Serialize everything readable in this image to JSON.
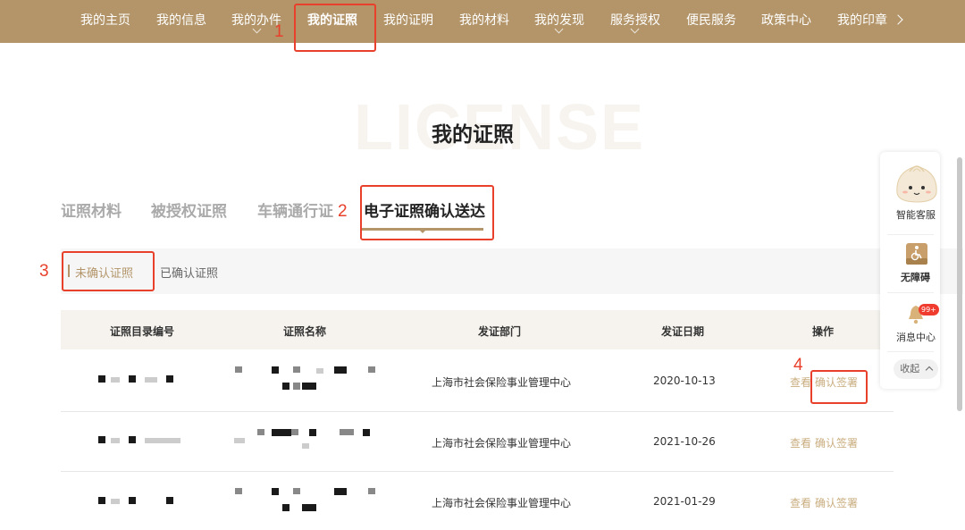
{
  "nav": {
    "items": [
      {
        "label": "我的主页"
      },
      {
        "label": "我的信息"
      },
      {
        "label": "我的办件"
      },
      {
        "label": "我的证照"
      },
      {
        "label": "我的证明"
      },
      {
        "label": "我的材料"
      },
      {
        "label": "我的发现"
      },
      {
        "label": "服务授权"
      },
      {
        "label": "便民服务"
      },
      {
        "label": "政策中心"
      },
      {
        "label": "我的印章"
      }
    ],
    "active_label": "我的证照"
  },
  "annotations": [
    "1",
    "2",
    "3",
    "4"
  ],
  "page": {
    "bg_word": "LICENSE",
    "title": "我的证照"
  },
  "tabs": [
    {
      "label": "证照材料"
    },
    {
      "label": "被授权证照"
    },
    {
      "label": "车辆通行证"
    },
    {
      "label": "电子证照确认送达"
    }
  ],
  "active_tab": "电子证照确认送达",
  "subtabs": [
    {
      "label": "未确认证照"
    },
    {
      "label": "已确认证照"
    }
  ],
  "table": {
    "headers": [
      "证照目录编号",
      "证照名称",
      "发证部门",
      "发证日期",
      "操作"
    ],
    "rows": [
      {
        "department": "上海市社会保险事业管理中心",
        "date": "2020-10-13",
        "view": "查看",
        "confirm": "确认签署"
      },
      {
        "department": "上海市社会保险事业管理中心",
        "date": "2021-10-26",
        "view": "查看",
        "confirm": "确认签署"
      },
      {
        "department": "上海市社会保险事业管理中心",
        "date": "2021-01-29",
        "view": "查看",
        "confirm": "确认签署"
      }
    ]
  },
  "side_panel": {
    "service": "智能客服",
    "accessibility": "无障碍",
    "messages": "消息中心",
    "badge": "99+",
    "collapse": "收起"
  },
  "colors": {
    "brand": "#b39569",
    "annotation": "#e8402b",
    "link": "#c9ad7f"
  }
}
